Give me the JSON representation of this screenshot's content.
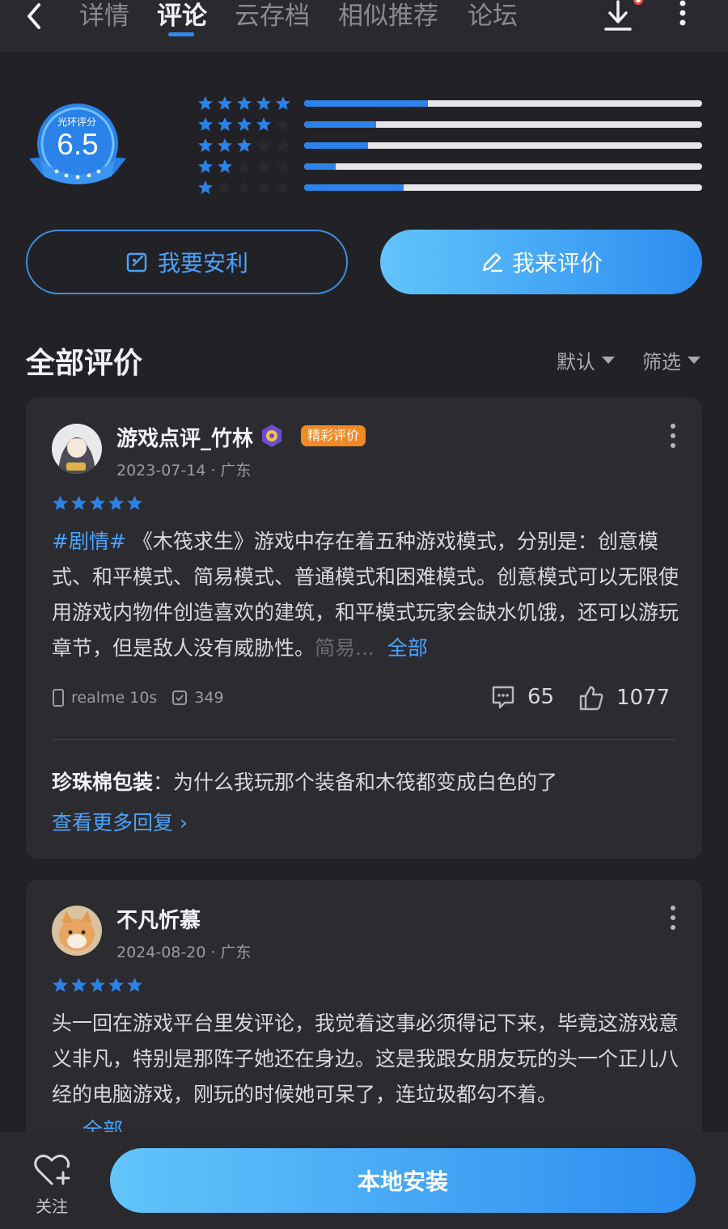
{
  "nav": {
    "tabs": [
      "详情",
      "评论",
      "云存档",
      "相似推荐",
      "论坛"
    ],
    "active_tab": "评论"
  },
  "score": {
    "label": "光环评分",
    "value": "6.5",
    "distribution": [
      {
        "stars": 5,
        "fraction": 0.31
      },
      {
        "stars": 4,
        "fraction": 0.18
      },
      {
        "stars": 3,
        "fraction": 0.16
      },
      {
        "stars": 2,
        "fraction": 0.08
      },
      {
        "stars": 1,
        "fraction": 0.25
      }
    ]
  },
  "actions": {
    "recommend_label": "我要安利",
    "review_label": "我来评价"
  },
  "section": {
    "title": "全部评价",
    "sort_label": "默认",
    "filter_label": "筛选"
  },
  "reviews": [
    {
      "username": "游戏点评_竹林",
      "tag": "精彩评价",
      "meta": "2023-07-14 · 广东",
      "stars": 5,
      "hashtag": "#剧情#",
      "text_main": " 《木筏求生》游戏中存在着五种游戏模式，分别是：创意模式、和平模式、简易模式、普通模式和困难模式。创意模式可以无限使用游戏内物件创造喜欢的建筑，和平模式玩家会缺水饥饿，还可以游玩章节，但是敌人没有威胁性。",
      "text_fade": "简易...",
      "all_label": "全部",
      "device": "realme 10s",
      "device_count": "349",
      "comments": "65",
      "likes": "1077",
      "reply_user": "珍珠棉包装",
      "reply_text": "：为什么我玩那个装备和木筏都变成白色的了",
      "more_replies": "查看更多回复 ›"
    },
    {
      "username": "不凡忻慕",
      "meta": "2024-08-20 · 广东",
      "stars": 5,
      "text_main": "头一回在游戏平台里发评论，我觉着这事必须得记下来，毕竟这游戏意义非凡，特别是那阵子她还在身边。这是我跟女朋友玩的头一个正儿八经的电脑游戏，刚玩的时候她可呆了，连垃圾都勾不着。",
      "all_label": "全部"
    }
  ],
  "bottom": {
    "follow_label": "关注",
    "install_label": "本地安装"
  },
  "colors": {
    "accent": "#2d8cf0",
    "background": "#222226",
    "card": "#2c2c30",
    "tag": "#f08a24"
  }
}
